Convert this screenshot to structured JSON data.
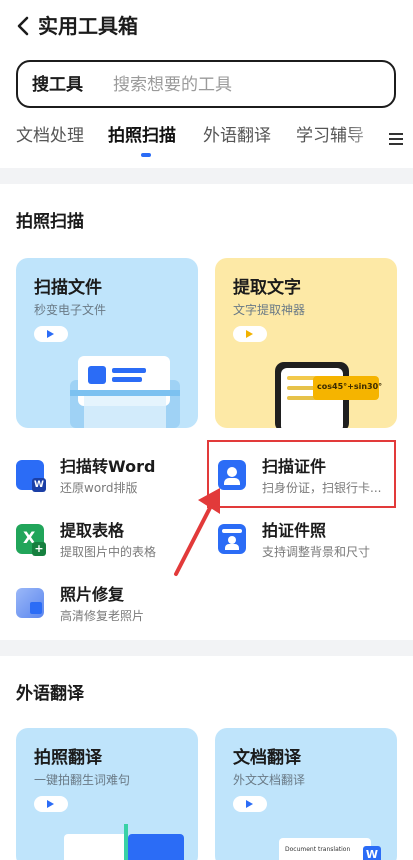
{
  "header": {
    "title": "实用工具箱"
  },
  "search": {
    "brand": "搜工具",
    "placeholder": "搜索想要的工具"
  },
  "tabs": [
    "文档处理",
    "拍照扫描",
    "外语翻译",
    "学习辅导"
  ],
  "scan": {
    "title": "拍照扫描",
    "cards": [
      {
        "title": "扫描文件",
        "subtitle": "秒变电子文件"
      },
      {
        "title": "提取文字",
        "subtitle": "文字提取神器",
        "formula": "cos45°+sin30°"
      }
    ],
    "tools": [
      {
        "name": "扫描转Word",
        "desc": "还原word排版"
      },
      {
        "name": "扫描证件",
        "desc": "扫身份证，扫银行卡..."
      },
      {
        "name": "提取表格",
        "desc": "提取图片中的表格"
      },
      {
        "name": "拍证件照",
        "desc": "支持调整背景和尺寸"
      },
      {
        "name": "照片修复",
        "desc": "高清修复老照片"
      }
    ]
  },
  "translate": {
    "title": "外语翻译",
    "cards": [
      {
        "title": "拍照翻译",
        "subtitle": "一键拍翻生词难句"
      },
      {
        "title": "文档翻译",
        "subtitle": "外文文档翻译",
        "doc_label": "Document translation"
      }
    ]
  },
  "colors": {
    "accent": "#2b6cf6",
    "highlight": "#e23a3a"
  }
}
